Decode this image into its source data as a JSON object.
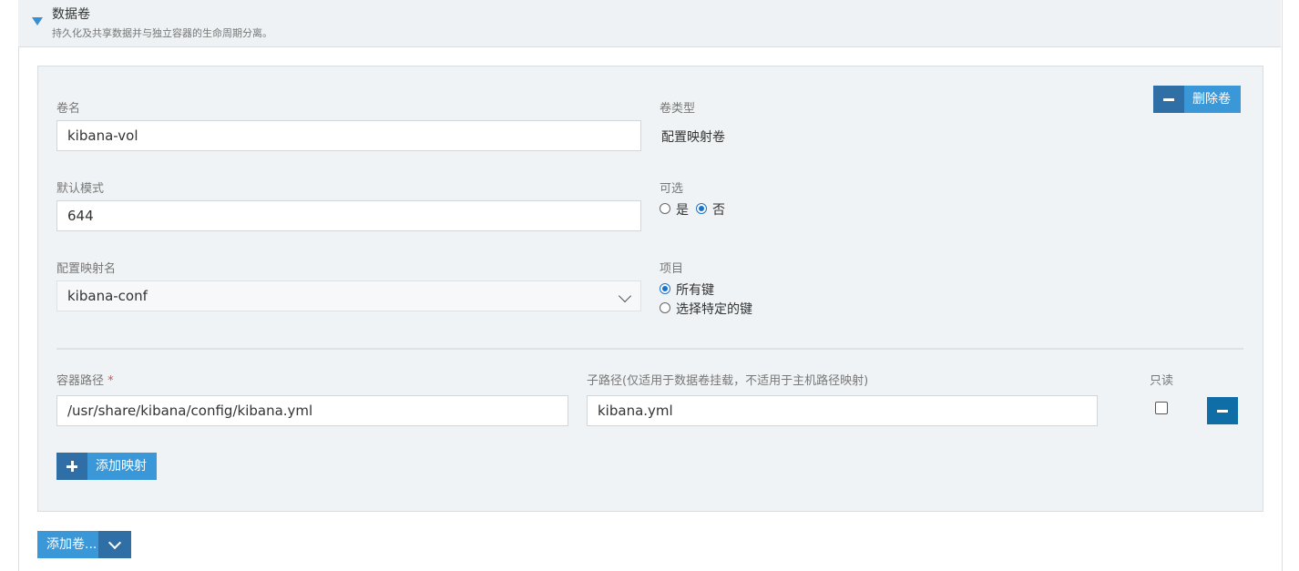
{
  "section": {
    "title": "数据卷",
    "subtitle": "持久化及共享数据并与独立容器的生命周期分离。"
  },
  "volume": {
    "name_label": "卷名",
    "name_value": "kibana-vol",
    "type_label": "卷类型",
    "type_value": "配置映射卷",
    "remove_button": "删除卷",
    "mode_label": "默认模式",
    "mode_value": "644",
    "optional_label": "可选",
    "optional_options": [
      "是",
      "否"
    ],
    "optional_selected": "否",
    "configmap_label": "配置映射名",
    "configmap_value": "kibana-conf",
    "items_label": "项目",
    "items_options": [
      "所有键",
      "选择特定的键"
    ],
    "items_selected": "所有键"
  },
  "mount": {
    "container_path_label": "容器路径",
    "required_mark": "*",
    "container_path_value": "/usr/share/kibana/config/kibana.yml",
    "subpath_label": "子路径(仅适用于数据卷挂载，不适用于主机路径映射)",
    "subpath_value": "kibana.yml",
    "readonly_label": "只读",
    "readonly_checked": false,
    "add_mapping_button": "添加映射"
  },
  "footer": {
    "add_volume_button": "添加卷..."
  },
  "colors": {
    "accent": "#3a98d8",
    "accent_dark": "#2f6fa5",
    "remove_row": "#0f6ea6"
  },
  "icons": {
    "collapse": "caret-down-icon",
    "remove": "minus-icon",
    "add": "plus-icon",
    "dropdown": "chevron-down-icon"
  }
}
